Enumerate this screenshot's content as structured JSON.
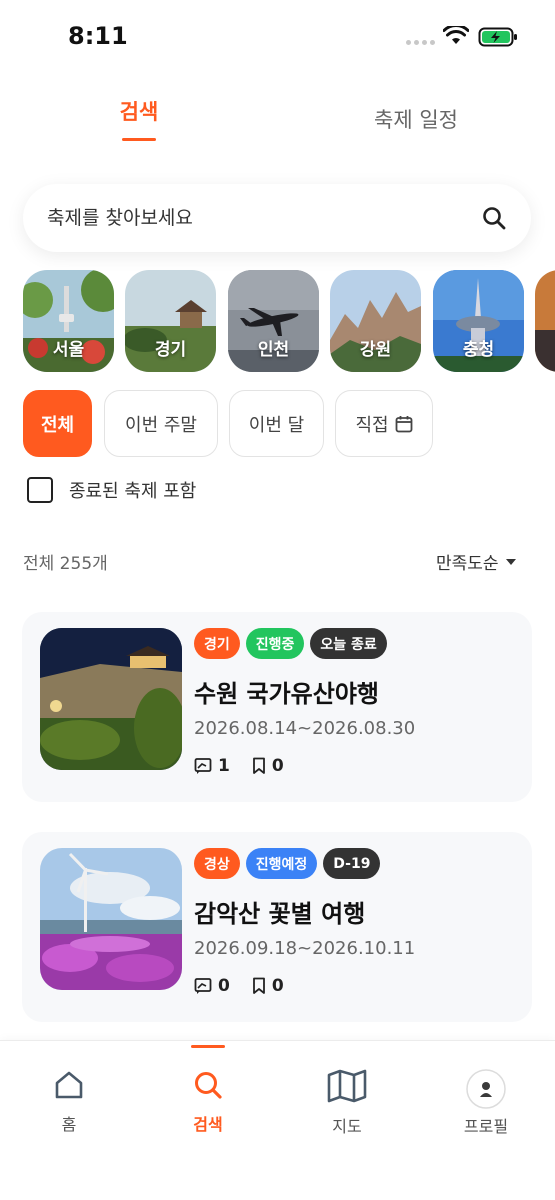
{
  "status_bar": {
    "time": "8:11"
  },
  "top_tabs": {
    "search": "검색",
    "schedule": "축제 일정"
  },
  "search": {
    "placeholder": "축제를 찾아보세요"
  },
  "regions": [
    {
      "label": "서울"
    },
    {
      "label": "경기"
    },
    {
      "label": "인천"
    },
    {
      "label": "강원"
    },
    {
      "label": "충청"
    }
  ],
  "filters": {
    "all": "전체",
    "this_weekend": "이번 주말",
    "this_month": "이번 달",
    "custom": "직접"
  },
  "include_ended": {
    "label": "종료된 축제 포함",
    "checked": false
  },
  "results": {
    "count": "전체 255개",
    "sort": "만족도순"
  },
  "cards": [
    {
      "badges": [
        {
          "text": "경기",
          "color": "#ff5a1f"
        },
        {
          "text": "진행중",
          "color": "#22c55e"
        },
        {
          "text": "오늘 종료",
          "color": "#333333"
        }
      ],
      "title": "수원 국가유산야행",
      "dates": "2026.08.14~2026.08.30",
      "reviews": "1",
      "bookmarks": "0"
    },
    {
      "badges": [
        {
          "text": "경상",
          "color": "#ff5a1f"
        },
        {
          "text": "진행예정",
          "color": "#3b82f6"
        },
        {
          "text": "D-19",
          "color": "#333333"
        }
      ],
      "title": "감악산 꽃별 여행",
      "dates": "2026.09.18~2026.10.11",
      "reviews": "0",
      "bookmarks": "0"
    }
  ],
  "bottom_nav": {
    "home": "홈",
    "search": "검색",
    "map": "지도",
    "profile": "프로필"
  },
  "colors": {
    "accent": "#ff5a1f",
    "ongoing": "#22c55e",
    "upcoming": "#3b82f6",
    "dark_badge": "#333333"
  }
}
